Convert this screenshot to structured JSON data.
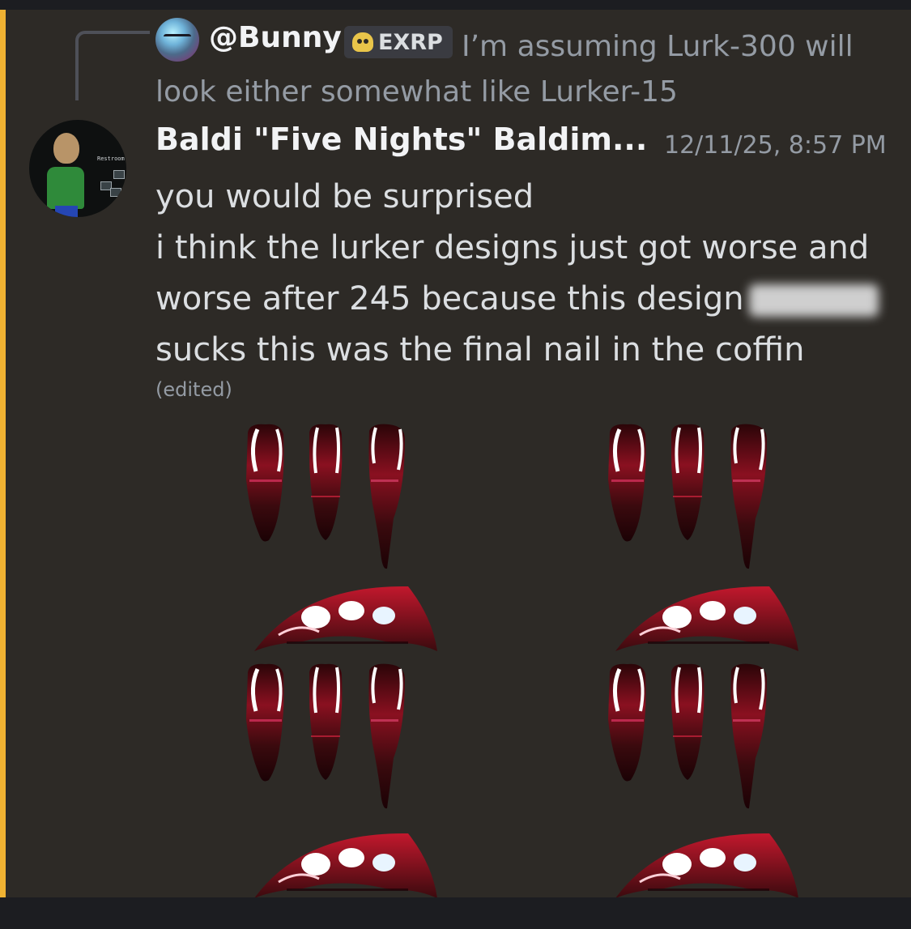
{
  "reply": {
    "username": "@Bunny",
    "tag": "EXRP",
    "tag_icon": "skull-icon",
    "text": "I’m assuming Lurk-300 will look either somewhat like Lurker-15"
  },
  "message": {
    "author": "Baldi \"Five Nights\" Baldim...",
    "timestamp": "12/11/25, 8:57 PM",
    "avatar_sign": "Restroom",
    "lines": [
      "you would be surprised",
      "i think the lurker designs just got worse and",
      "worse after 245 because this design",
      "sucks this was the final nail in the coffin"
    ],
    "edited": "(edited)"
  },
  "colors": {
    "background": "#2d2a26",
    "mention_bar": "#f0b232",
    "sprite_dark": "#3a0a0e",
    "sprite_red": "#b3152a",
    "sprite_highlight": "#ffffff"
  }
}
